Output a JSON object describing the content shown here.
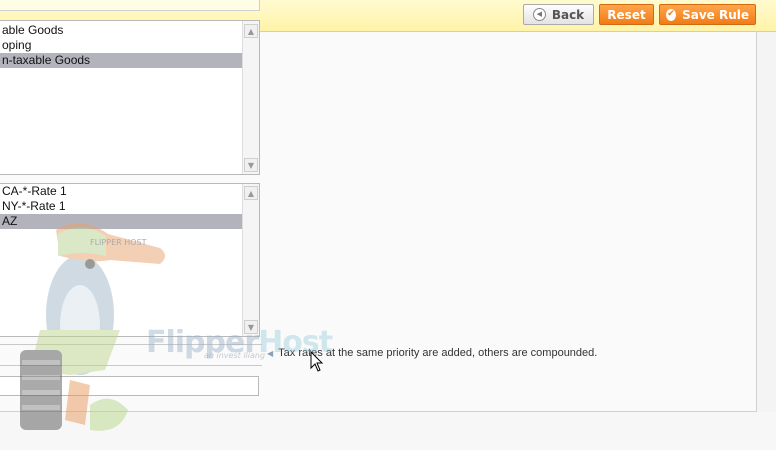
{
  "header": {
    "back_label": "Back",
    "reset_label": "Reset",
    "save_label": "Save Rule"
  },
  "product_tax_class": {
    "items": [
      {
        "label": "able Goods",
        "selected": false
      },
      {
        "label": "oping",
        "selected": false
      },
      {
        "label": "n-taxable Goods",
        "selected": true
      }
    ]
  },
  "tax_rate": {
    "items": [
      {
        "label": "CA-*-Rate 1",
        "selected": false
      },
      {
        "label": "NY-*-Rate 1",
        "selected": false
      },
      {
        "label": "AZ",
        "selected": true
      }
    ]
  },
  "priority": {
    "note": "Tax rates at the same priority are added, others are compounded."
  },
  "watermark": {
    "brand_a": "Flipper",
    "brand_b": "Host",
    "tagline": "an invest iliang",
    "cap_text": "FLIPPER HOST"
  },
  "colors": {
    "header_bg": "#fff3a8",
    "accent_orange": "#f07c18",
    "selected_row": "#b3b3be"
  }
}
